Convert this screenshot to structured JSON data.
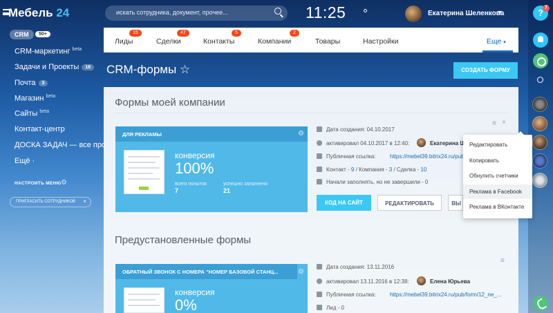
{
  "logo": {
    "text": "Мебель",
    "accent": "24"
  },
  "left_menu": {
    "crm": {
      "label": "CRM",
      "count": "50+"
    },
    "items": [
      {
        "label": "CRM-маркетинг",
        "beta": "beta"
      },
      {
        "label": "Задачи и Проекты",
        "count": "16"
      },
      {
        "label": "Почта",
        "count": "3"
      },
      {
        "label": "Магазин",
        "beta": "beta"
      },
      {
        "label": "Сайты",
        "beta": "beta"
      },
      {
        "label": "Контакт-центр"
      },
      {
        "label": "ДОСКА ЗАДАЧ — все про..."
      },
      {
        "label": "Ещё ·"
      }
    ],
    "setup": "НАСТРОИТЬ МЕНЮ",
    "invite": "ПРИГЛАСИТЬ СОТРУДНИКОВ"
  },
  "header": {
    "search_placeholder": "искать сотрудника, документ, прочее...",
    "clock": "11:25",
    "user_name": "Екатерина Шеленкова"
  },
  "right_bar": {
    "help_badge": "7"
  },
  "tabs": [
    {
      "label": "Лиды",
      "count": "15"
    },
    {
      "label": "Сделки",
      "count": "47"
    },
    {
      "label": "Контакты",
      "count": "5"
    },
    {
      "label": "Компании",
      "count": "2"
    },
    {
      "label": "Товары"
    },
    {
      "label": "Настройки"
    }
  ],
  "tab_more": "Еще",
  "page": {
    "title": "CRM-формы ☆",
    "create_button": "СОЗДАТЬ ФОРМУ"
  },
  "section1": {
    "title": "Формы моей компании",
    "card": {
      "header": "ДЛЯ РЕКЛАМЫ",
      "conv_label": "конверсия",
      "conv_value": "100%",
      "attempts_label": "всего попыток",
      "attempts": "7",
      "filled_label": "успешно заполнено",
      "filled": "21"
    },
    "meta": {
      "created": "Дата создания:  04.10.2017",
      "activated": "активировал 04.10.2017 в 12:40:",
      "activated_by": "Екатерина Ш",
      "public_label": "Публичная ссылка:",
      "public_link": "https://mebel39.bitrix24.ru/pub/f",
      "crm_prefix": "Контакт - ",
      "crm_contact": "9",
      "crm_company_label": " / Компания - ",
      "crm_company": "3",
      "crm_deal_label": " / Сделка - ",
      "crm_deal": "10",
      "started": "Начали заполнять, но не завершили - 0"
    },
    "buttons": {
      "code": "КОД НА САЙТ",
      "edit": "РЕДАКТИРОВАТЬ",
      "more": "ВЫ"
    }
  },
  "dropdown": {
    "items": [
      "Редактировать",
      "Копировать",
      "Обнулить счетчики",
      "Реклама в Facebook",
      "Реклама в ВКонтакте"
    ],
    "highlight_index": 3
  },
  "section2": {
    "title": "Предустановленные формы",
    "card": {
      "header": "ОБРАТНЫЙ ЗВОНОК С НОМЕРА \"НОМЕР БАЗОВОЙ СТАНЦ...",
      "conv_label": "конверсия",
      "conv_value": "0%"
    },
    "meta": {
      "created": "Дата создания:  13.11.2016",
      "activated": "активировал 13.11.2016 в 12:38:",
      "activated_by": "Елена Юрьева",
      "public_label": "Публичная ссылка:",
      "public_link": "https://mebel39.bitrix24.ru/pub/form/12_ne_...",
      "lead": "Лид - 0"
    }
  }
}
